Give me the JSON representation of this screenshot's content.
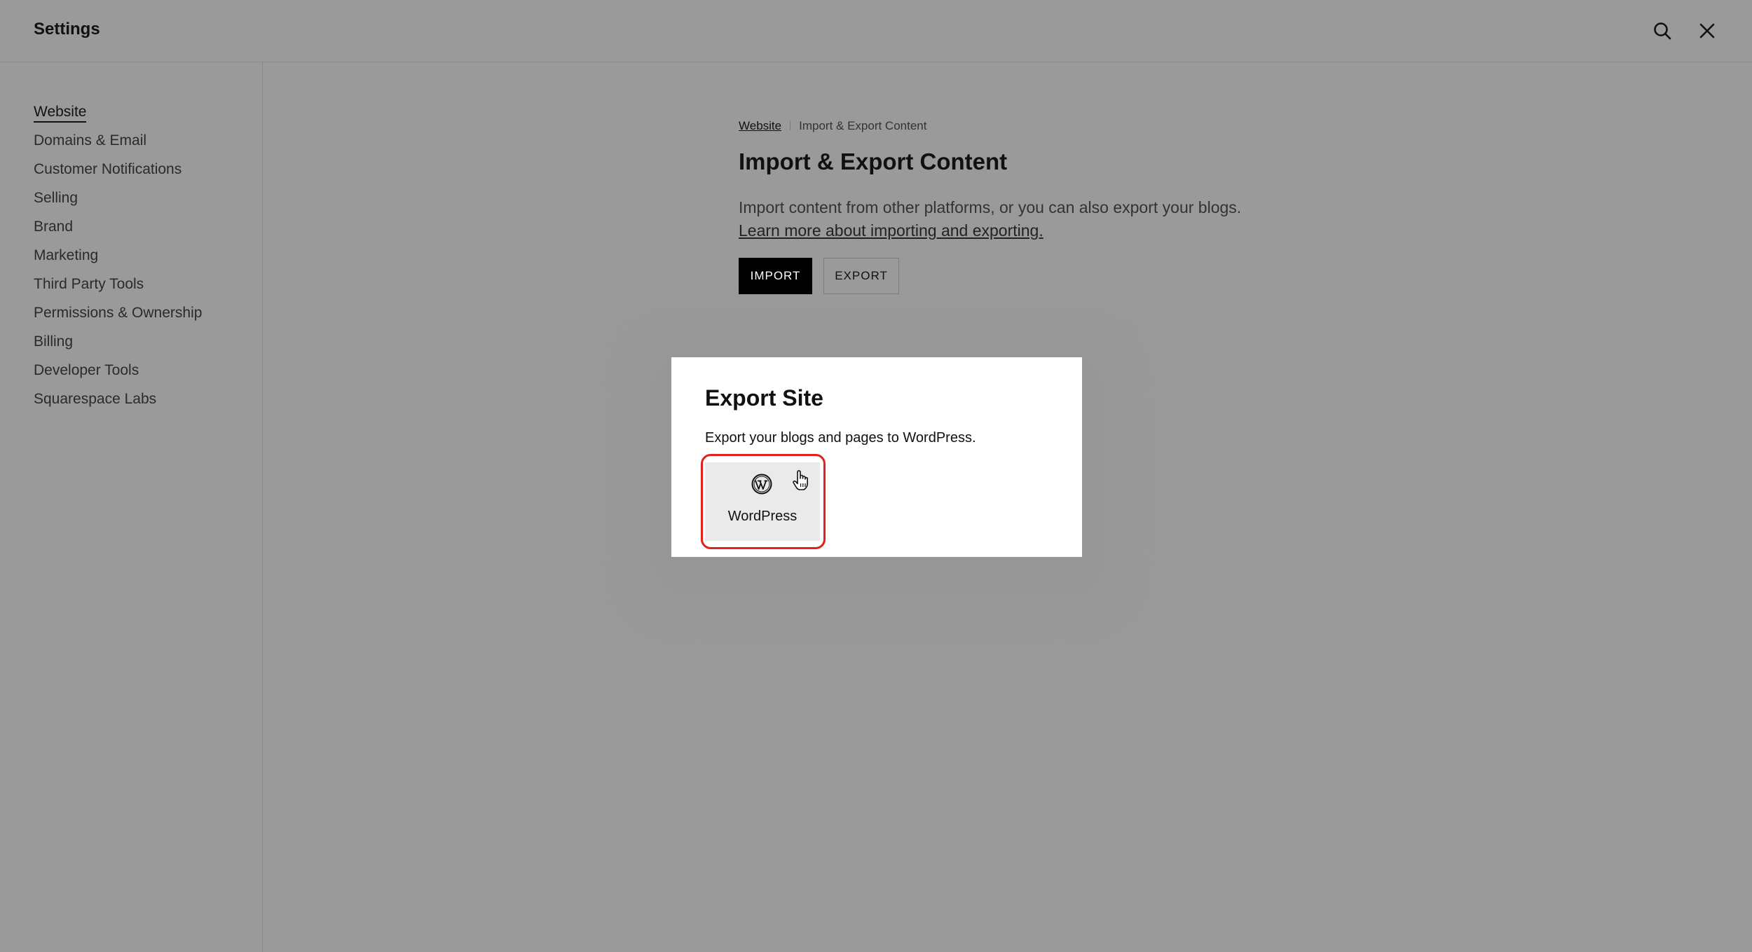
{
  "header": {
    "title": "Settings",
    "search_icon": "search-icon",
    "close_icon": "close-icon"
  },
  "sidebar": {
    "items": [
      {
        "label": "Website",
        "active": true
      },
      {
        "label": "Domains & Email"
      },
      {
        "label": "Customer Notifications"
      },
      {
        "label": "Selling"
      },
      {
        "label": "Brand"
      },
      {
        "label": "Marketing"
      },
      {
        "label": "Third Party Tools"
      },
      {
        "label": "Permissions & Ownership"
      },
      {
        "label": "Billing"
      },
      {
        "label": "Developer Tools"
      },
      {
        "label": "Squarespace Labs"
      }
    ]
  },
  "main": {
    "breadcrumb": {
      "parent": "Website",
      "current": "Import & Export Content"
    },
    "title": "Import & Export Content",
    "description": "Import content from other platforms, or you can also export your blogs. ",
    "learn_more": "Learn more about importing and exporting.",
    "buttons": {
      "import": "IMPORT",
      "export": "EXPORT"
    }
  },
  "modal": {
    "title": "Export Site",
    "description": "Export your blogs and pages to WordPress.",
    "option": {
      "label": "WordPress",
      "icon": "wordpress-icon"
    }
  },
  "colors": {
    "overlay_bg": "#9a9a9a",
    "primary_button_bg": "#000000",
    "highlight": "#e3211c",
    "tile_bg": "#eaeaea"
  }
}
